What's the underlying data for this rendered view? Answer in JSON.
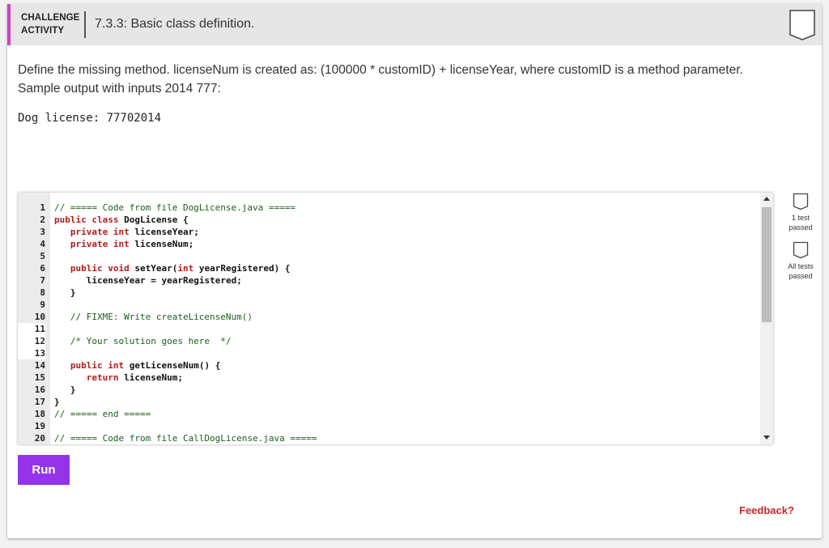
{
  "header": {
    "activity_line1": "CHALLENGE",
    "activity_line2": "ACTIVITY",
    "title": "7.3.3: Basic class definition."
  },
  "description": {
    "line1": "Define the missing method. licenseNum is created as: (100000 * customID) + licenseYear, where customID is a method parameter.",
    "line2": "Sample output with inputs 2014 777:"
  },
  "sample_output": "Dog license: 77702014",
  "editor": {
    "lines": [
      {
        "n": "1",
        "t": "// ===== Code from file DogLicense.java ====="
      },
      {
        "n": "2",
        "t": "public class DogLicense {"
      },
      {
        "n": "3",
        "t": "   private int licenseYear;"
      },
      {
        "n": "4",
        "t": "   private int licenseNum;"
      },
      {
        "n": "5",
        "t": ""
      },
      {
        "n": "6",
        "t": "   public void setYear(int yearRegistered) {"
      },
      {
        "n": "7",
        "t": "      licenseYear = yearRegistered;"
      },
      {
        "n": "8",
        "t": "   }"
      },
      {
        "n": "9",
        "t": ""
      },
      {
        "n": "10",
        "t": "   // FIXME: Write createLicenseNum()"
      },
      {
        "n": "11",
        "t": ""
      },
      {
        "n": "12",
        "t": "   /* Your solution goes here  */"
      },
      {
        "n": "13",
        "t": ""
      },
      {
        "n": "14",
        "t": "   public int getLicenseNum() {"
      },
      {
        "n": "15",
        "t": "      return licenseNum;"
      },
      {
        "n": "16",
        "t": "   }"
      },
      {
        "n": "17",
        "t": "}"
      },
      {
        "n": "18",
        "t": "// ===== end ====="
      },
      {
        "n": "19",
        "t": ""
      },
      {
        "n": "20",
        "t": "// ===== Code from file CallDogLicense.java ====="
      }
    ]
  },
  "test_badges": [
    {
      "label_line1": "1 test",
      "label_line2": "passed"
    },
    {
      "label_line1": "All tests",
      "label_line2": "passed"
    }
  ],
  "run_label": "Run",
  "feedback_label": "Feedback?",
  "colors": {
    "accent": "#9333ea",
    "header_bar": "#d43fc4",
    "feedback": "#c62828"
  }
}
